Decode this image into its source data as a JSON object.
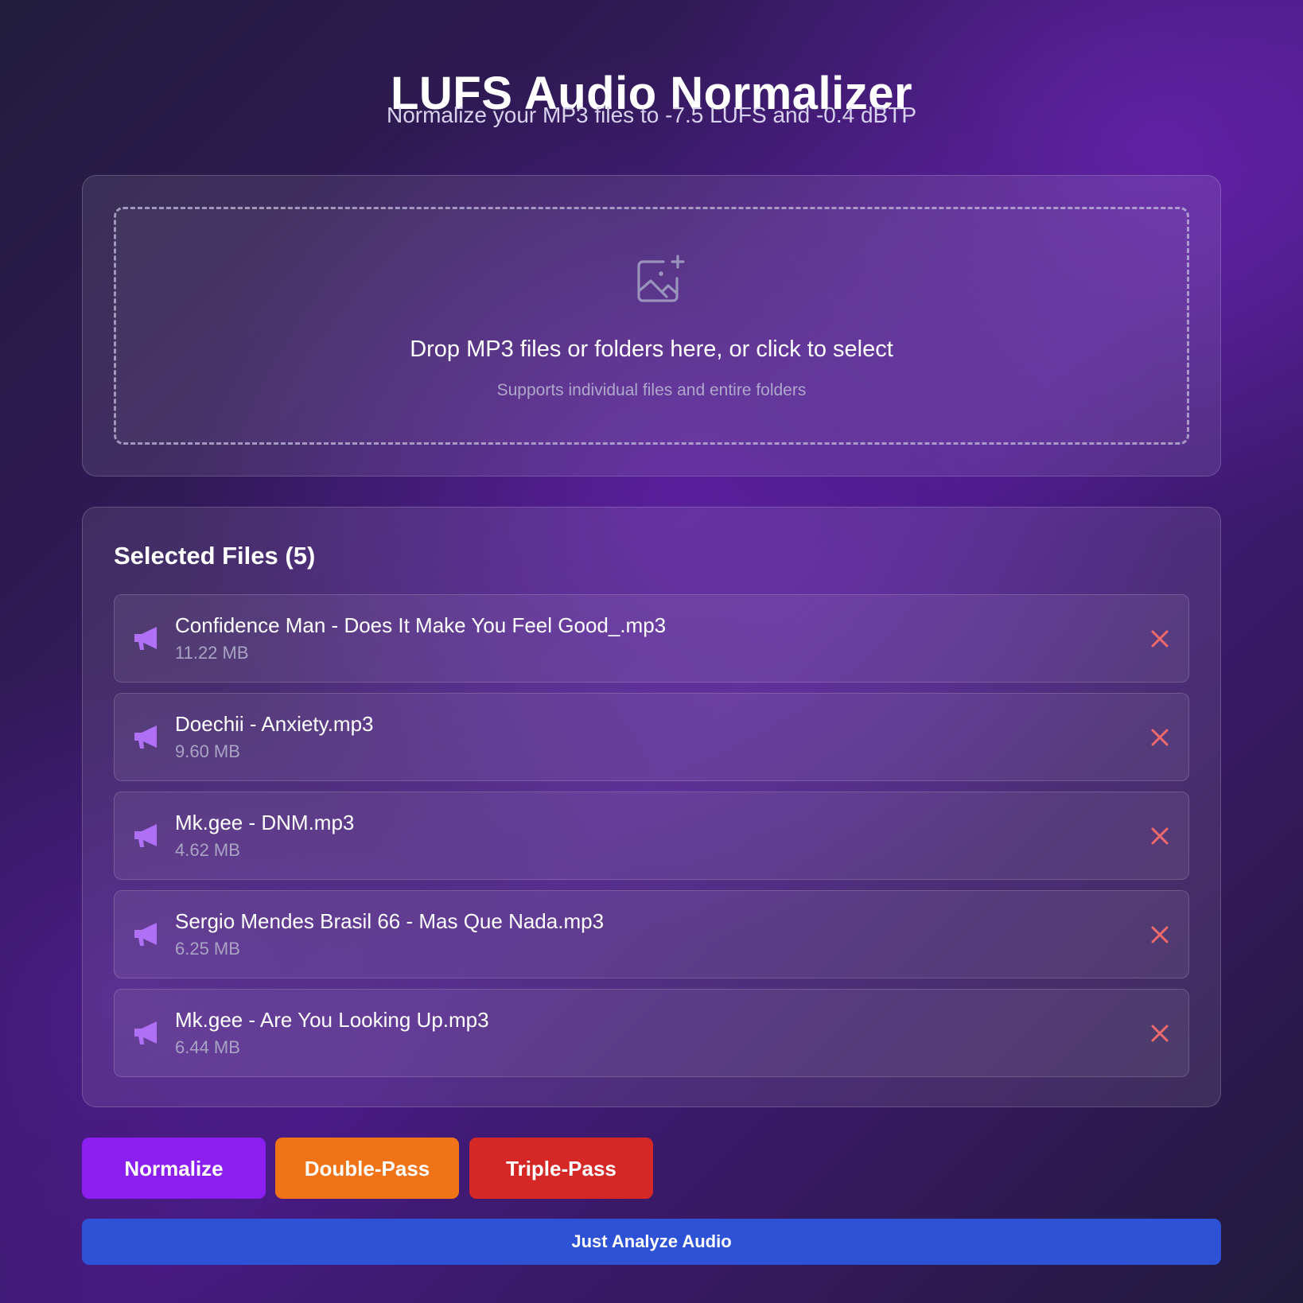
{
  "header": {
    "title": "LUFS Audio Normalizer",
    "subtitle": "Normalize your MP3 files to -7.5 LUFS and -0.4 dBTP"
  },
  "dropzone": {
    "title": "Drop MP3 files or folders here, or click to select",
    "subtitle": "Supports individual files and entire folders",
    "icon": "image-add-icon"
  },
  "files": {
    "heading": "Selected Files (5)",
    "items": [
      {
        "name": "Confidence Man - Does It Make You Feel Good_.mp3",
        "size": "11.22 MB",
        "icon": "megaphone-icon",
        "remove_icon": "close-icon"
      },
      {
        "name": "Doechii - Anxiety.mp3",
        "size": "9.60 MB",
        "icon": "megaphone-icon",
        "remove_icon": "close-icon"
      },
      {
        "name": "Mk.gee - DNM.mp3",
        "size": "4.62 MB",
        "icon": "megaphone-icon",
        "remove_icon": "close-icon"
      },
      {
        "name": "Sergio Mendes Brasil 66 - Mas Que Nada.mp3",
        "size": "6.25 MB",
        "icon": "megaphone-icon",
        "remove_icon": "close-icon"
      },
      {
        "name": "Mk.gee - Are You Looking Up.mp3",
        "size": "6.44 MB",
        "icon": "megaphone-icon",
        "remove_icon": "close-icon"
      }
    ]
  },
  "actions": {
    "normalize": "Normalize",
    "double_pass": "Double-Pass",
    "triple_pass": "Triple-Pass",
    "analyze": "Just Analyze Audio"
  },
  "colors": {
    "normalize": "#8a1ff0",
    "double_pass": "#f07317",
    "triple_pass": "#d62727",
    "analyze": "#2e52d6",
    "file_icon": "#b070f5",
    "remove_icon": "#f06a6a"
  }
}
